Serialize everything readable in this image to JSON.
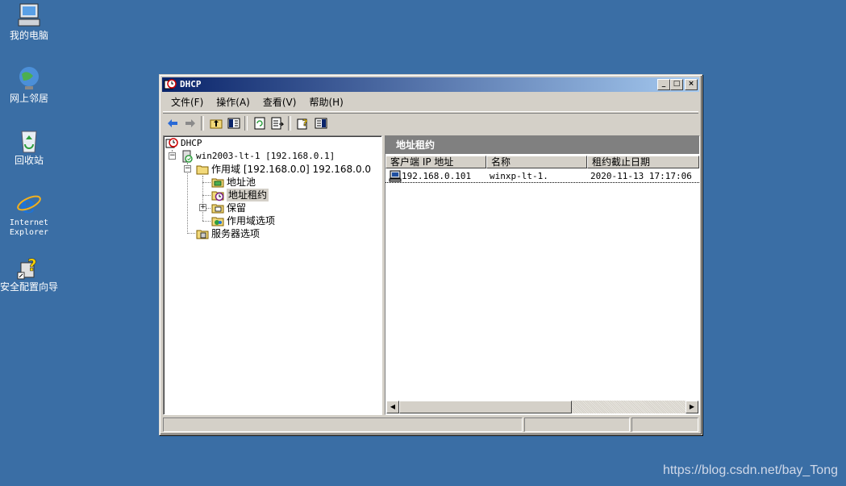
{
  "desktop": {
    "icons": [
      {
        "label": "我的电脑",
        "icon": "my-computer-icon"
      },
      {
        "label": "网上邻居",
        "icon": "network-places-icon"
      },
      {
        "label": "回收站",
        "icon": "recycle-bin-icon"
      },
      {
        "label": "Internet\nExplorer",
        "icon": "internet-explorer-icon"
      },
      {
        "label": "安全配置向导",
        "icon": "security-wizard-icon"
      }
    ],
    "watermark": "https://blog.csdn.net/bay_Tong"
  },
  "window": {
    "title": "DHCP",
    "buttons": {
      "minimize": "_",
      "maximize": "□",
      "close": "×"
    },
    "menu": [
      "文件(F)",
      "操作(A)",
      "查看(V)",
      "帮助(H)"
    ],
    "toolbar": [
      "back-icon",
      "forward-icon",
      "up-icon",
      "show-hide-tree-icon",
      "refresh-icon",
      "export-list-icon",
      "help-icon",
      "properties-icon"
    ]
  },
  "tree": {
    "root": "DHCP",
    "server": "win2003-lt-1 [192.168.0.1]",
    "scope": "作用域 [192.168.0.0] 192.168.0.0",
    "address_pool": "地址池",
    "address_leases": "地址租约",
    "reservations": "保留",
    "scope_options": "作用域选项",
    "server_options": "服务器选项"
  },
  "details": {
    "header": "地址租约",
    "columns": [
      "客户端 IP 地址",
      "名称",
      "租约截止日期"
    ],
    "rows": [
      {
        "ip": "192.168.0.101",
        "name": "winxp-lt-1.",
        "expiry": "2020-11-13 17:17:06"
      }
    ]
  },
  "colors": {
    "desktop": "#3a6ea5",
    "title_start": "#0a246a",
    "title_end": "#a6caf0",
    "chrome": "#d4d0c8"
  }
}
